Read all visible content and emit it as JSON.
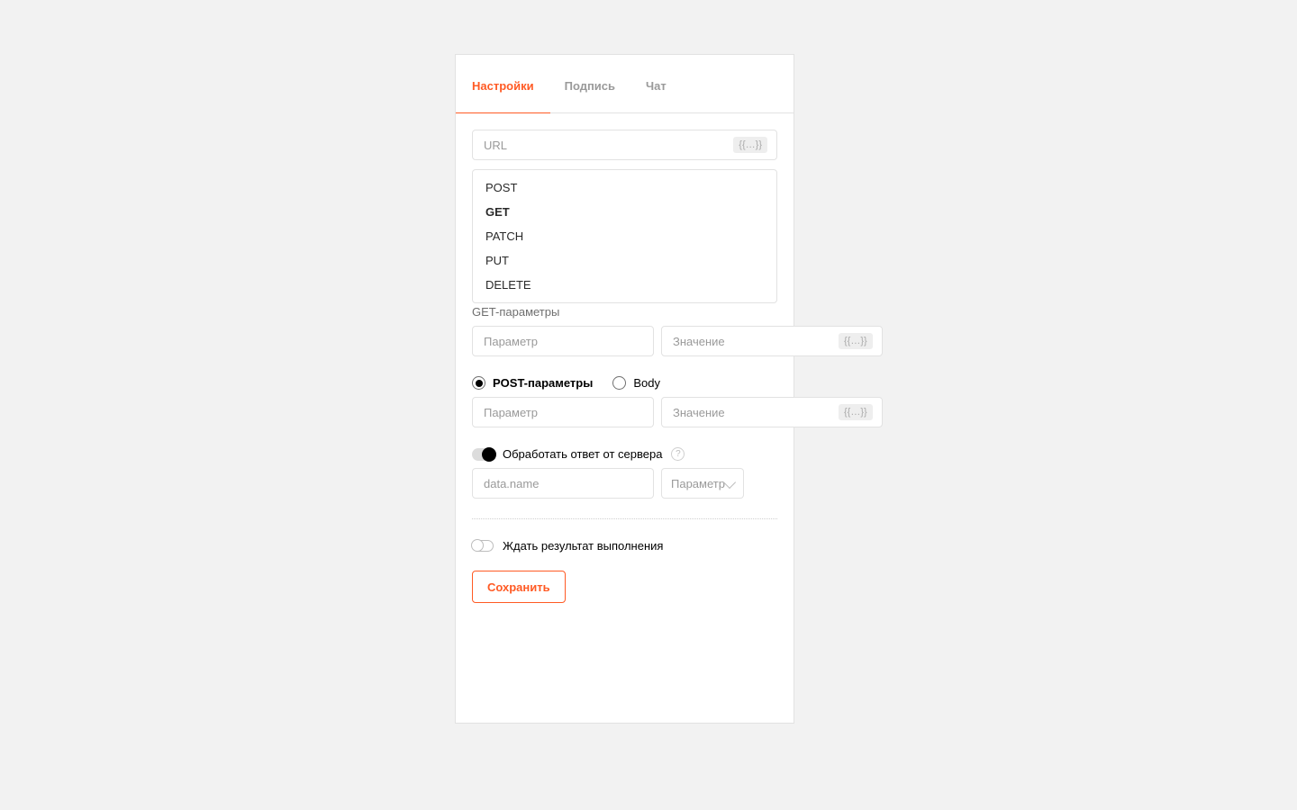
{
  "tabs": {
    "settings": "Настройки",
    "signature": "Подпись",
    "chat": "Чат"
  },
  "url_field": {
    "placeholder": "URL",
    "braces": "{{…}}"
  },
  "method_dropdown": {
    "options": [
      "POST",
      "GET",
      "PATCH",
      "PUT",
      "DELETE"
    ],
    "selected": "GET"
  },
  "get_params": {
    "section_label": "GET-параметры",
    "key_placeholder": "Параметр",
    "value_placeholder": "Значение",
    "braces": "{{…}}"
  },
  "post_body_radio": {
    "post_label": "POST-параметры",
    "body_label": "Body"
  },
  "post_params": {
    "key_placeholder": "Параметр",
    "value_placeholder": "Значение",
    "braces": "{{…}}"
  },
  "process_response": {
    "label": "Обработать ответ от сервера",
    "help": "?",
    "path_placeholder": "data.name",
    "param_placeholder": "Параметр"
  },
  "wait_result": {
    "label": "Ждать результат выполнения"
  },
  "save_button": "Сохранить"
}
